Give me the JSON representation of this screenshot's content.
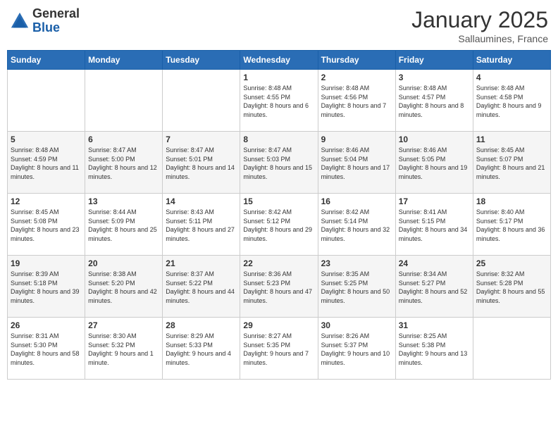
{
  "header": {
    "logo_general": "General",
    "logo_blue": "Blue",
    "month_year": "January 2025",
    "location": "Sallaumines, France"
  },
  "weekdays": [
    "Sunday",
    "Monday",
    "Tuesday",
    "Wednesday",
    "Thursday",
    "Friday",
    "Saturday"
  ],
  "weeks": [
    [
      {
        "day": "",
        "sunrise": "",
        "sunset": "",
        "daylight": ""
      },
      {
        "day": "",
        "sunrise": "",
        "sunset": "",
        "daylight": ""
      },
      {
        "day": "",
        "sunrise": "",
        "sunset": "",
        "daylight": ""
      },
      {
        "day": "1",
        "sunrise": "Sunrise: 8:48 AM",
        "sunset": "Sunset: 4:55 PM",
        "daylight": "Daylight: 8 hours and 6 minutes."
      },
      {
        "day": "2",
        "sunrise": "Sunrise: 8:48 AM",
        "sunset": "Sunset: 4:56 PM",
        "daylight": "Daylight: 8 hours and 7 minutes."
      },
      {
        "day": "3",
        "sunrise": "Sunrise: 8:48 AM",
        "sunset": "Sunset: 4:57 PM",
        "daylight": "Daylight: 8 hours and 8 minutes."
      },
      {
        "day": "4",
        "sunrise": "Sunrise: 8:48 AM",
        "sunset": "Sunset: 4:58 PM",
        "daylight": "Daylight: 8 hours and 9 minutes."
      }
    ],
    [
      {
        "day": "5",
        "sunrise": "Sunrise: 8:48 AM",
        "sunset": "Sunset: 4:59 PM",
        "daylight": "Daylight: 8 hours and 11 minutes."
      },
      {
        "day": "6",
        "sunrise": "Sunrise: 8:47 AM",
        "sunset": "Sunset: 5:00 PM",
        "daylight": "Daylight: 8 hours and 12 minutes."
      },
      {
        "day": "7",
        "sunrise": "Sunrise: 8:47 AM",
        "sunset": "Sunset: 5:01 PM",
        "daylight": "Daylight: 8 hours and 14 minutes."
      },
      {
        "day": "8",
        "sunrise": "Sunrise: 8:47 AM",
        "sunset": "Sunset: 5:03 PM",
        "daylight": "Daylight: 8 hours and 15 minutes."
      },
      {
        "day": "9",
        "sunrise": "Sunrise: 8:46 AM",
        "sunset": "Sunset: 5:04 PM",
        "daylight": "Daylight: 8 hours and 17 minutes."
      },
      {
        "day": "10",
        "sunrise": "Sunrise: 8:46 AM",
        "sunset": "Sunset: 5:05 PM",
        "daylight": "Daylight: 8 hours and 19 minutes."
      },
      {
        "day": "11",
        "sunrise": "Sunrise: 8:45 AM",
        "sunset": "Sunset: 5:07 PM",
        "daylight": "Daylight: 8 hours and 21 minutes."
      }
    ],
    [
      {
        "day": "12",
        "sunrise": "Sunrise: 8:45 AM",
        "sunset": "Sunset: 5:08 PM",
        "daylight": "Daylight: 8 hours and 23 minutes."
      },
      {
        "day": "13",
        "sunrise": "Sunrise: 8:44 AM",
        "sunset": "Sunset: 5:09 PM",
        "daylight": "Daylight: 8 hours and 25 minutes."
      },
      {
        "day": "14",
        "sunrise": "Sunrise: 8:43 AM",
        "sunset": "Sunset: 5:11 PM",
        "daylight": "Daylight: 8 hours and 27 minutes."
      },
      {
        "day": "15",
        "sunrise": "Sunrise: 8:42 AM",
        "sunset": "Sunset: 5:12 PM",
        "daylight": "Daylight: 8 hours and 29 minutes."
      },
      {
        "day": "16",
        "sunrise": "Sunrise: 8:42 AM",
        "sunset": "Sunset: 5:14 PM",
        "daylight": "Daylight: 8 hours and 32 minutes."
      },
      {
        "day": "17",
        "sunrise": "Sunrise: 8:41 AM",
        "sunset": "Sunset: 5:15 PM",
        "daylight": "Daylight: 8 hours and 34 minutes."
      },
      {
        "day": "18",
        "sunrise": "Sunrise: 8:40 AM",
        "sunset": "Sunset: 5:17 PM",
        "daylight": "Daylight: 8 hours and 36 minutes."
      }
    ],
    [
      {
        "day": "19",
        "sunrise": "Sunrise: 8:39 AM",
        "sunset": "Sunset: 5:18 PM",
        "daylight": "Daylight: 8 hours and 39 minutes."
      },
      {
        "day": "20",
        "sunrise": "Sunrise: 8:38 AM",
        "sunset": "Sunset: 5:20 PM",
        "daylight": "Daylight: 8 hours and 42 minutes."
      },
      {
        "day": "21",
        "sunrise": "Sunrise: 8:37 AM",
        "sunset": "Sunset: 5:22 PM",
        "daylight": "Daylight: 8 hours and 44 minutes."
      },
      {
        "day": "22",
        "sunrise": "Sunrise: 8:36 AM",
        "sunset": "Sunset: 5:23 PM",
        "daylight": "Daylight: 8 hours and 47 minutes."
      },
      {
        "day": "23",
        "sunrise": "Sunrise: 8:35 AM",
        "sunset": "Sunset: 5:25 PM",
        "daylight": "Daylight: 8 hours and 50 minutes."
      },
      {
        "day": "24",
        "sunrise": "Sunrise: 8:34 AM",
        "sunset": "Sunset: 5:27 PM",
        "daylight": "Daylight: 8 hours and 52 minutes."
      },
      {
        "day": "25",
        "sunrise": "Sunrise: 8:32 AM",
        "sunset": "Sunset: 5:28 PM",
        "daylight": "Daylight: 8 hours and 55 minutes."
      }
    ],
    [
      {
        "day": "26",
        "sunrise": "Sunrise: 8:31 AM",
        "sunset": "Sunset: 5:30 PM",
        "daylight": "Daylight: 8 hours and 58 minutes."
      },
      {
        "day": "27",
        "sunrise": "Sunrise: 8:30 AM",
        "sunset": "Sunset: 5:32 PM",
        "daylight": "Daylight: 9 hours and 1 minute."
      },
      {
        "day": "28",
        "sunrise": "Sunrise: 8:29 AM",
        "sunset": "Sunset: 5:33 PM",
        "daylight": "Daylight: 9 hours and 4 minutes."
      },
      {
        "day": "29",
        "sunrise": "Sunrise: 8:27 AM",
        "sunset": "Sunset: 5:35 PM",
        "daylight": "Daylight: 9 hours and 7 minutes."
      },
      {
        "day": "30",
        "sunrise": "Sunrise: 8:26 AM",
        "sunset": "Sunset: 5:37 PM",
        "daylight": "Daylight: 9 hours and 10 minutes."
      },
      {
        "day": "31",
        "sunrise": "Sunrise: 8:25 AM",
        "sunset": "Sunset: 5:38 PM",
        "daylight": "Daylight: 9 hours and 13 minutes."
      },
      {
        "day": "",
        "sunrise": "",
        "sunset": "",
        "daylight": ""
      }
    ]
  ]
}
